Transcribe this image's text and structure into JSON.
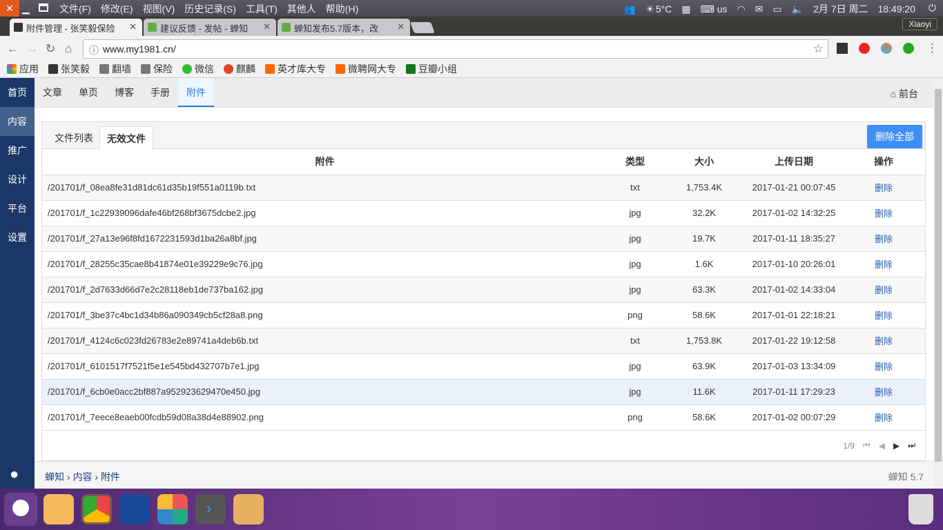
{
  "os": {
    "menu": [
      "文件(F)",
      "修改(E)",
      "视图(V)",
      "历史记录(S)",
      "工具(T)",
      "其他人",
      "帮助(H)"
    ],
    "temp": "5°C",
    "kbd": "us",
    "date": "2月 7日 周二",
    "time": "18:49:20",
    "user": "Xiaoyi"
  },
  "tabs": [
    {
      "title": "附件管理 - 张笑毅保险"
    },
    {
      "title": "建议反馈 - 发帖 - 蝉知"
    },
    {
      "title": "蝉知发布5.7版本，改"
    }
  ],
  "url": "www.my1981.cn/",
  "bookmarks": [
    "应用",
    "张笑毅",
    "翻墙",
    "保险",
    "微信",
    "麒麟",
    "英才库大专",
    "微聘网大专",
    "豆瓣小组"
  ],
  "sidebar": [
    "首页",
    "内容",
    "推广",
    "设计",
    "平台",
    "设置"
  ],
  "topnav": {
    "items": [
      "文章",
      "单页",
      "博客",
      "手册",
      "附件"
    ],
    "front": "前台"
  },
  "panel": {
    "tabs": [
      "文件列表",
      "无效文件"
    ],
    "delete_all": "删除全部"
  },
  "table": {
    "headers": [
      "附件",
      "类型",
      "大小",
      "上传日期",
      "操作"
    ],
    "rows": [
      [
        "/201701/f_08ea8fe31d81dc61d35b19f551a0119b.txt",
        "txt",
        "1,753.4K",
        "2017-01-21 00:07:45",
        "删除"
      ],
      [
        "/201701/f_1c22939096dafe46bf268bf3675dcbe2.jpg",
        "jpg",
        "32.2K",
        "2017-01-02 14:32:25",
        "删除"
      ],
      [
        "/201701/f_27a13e96f8fd1672231593d1ba26a8bf.jpg",
        "jpg",
        "19.7K",
        "2017-01-11 18:35:27",
        "删除"
      ],
      [
        "/201701/f_28255c35cae8b41874e01e39229e9c76.jpg",
        "jpg",
        "1.6K",
        "2017-01-10 20:26:01",
        "删除"
      ],
      [
        "/201701/f_2d7633d66d7e2c28118eb1de737ba162.jpg",
        "jpg",
        "63.3K",
        "2017-01-02 14:33:04",
        "删除"
      ],
      [
        "/201701/f_3be37c4bc1d34b86a090349cb5cf28a8.png",
        "png",
        "58.6K",
        "2017-01-01 22:18:21",
        "删除"
      ],
      [
        "/201701/f_4124c6c023fd26783e2e89741a4deb6b.txt",
        "txt",
        "1,753.8K",
        "2017-01-22 19:12:58",
        "删除"
      ],
      [
        "/201701/f_6101517f7521f5e1e545bd432707b7e1.jpg",
        "jpg",
        "63.9K",
        "2017-01-03 13:34:09",
        "删除"
      ],
      [
        "/201701/f_6cb0e0acc2bf887a952923629470e450.jpg",
        "jpg",
        "11.6K",
        "2017-01-11 17:29:23",
        "删除"
      ],
      [
        "/201701/f_7eece8eaeb00fcdb59d08a38d4e88902.png",
        "png",
        "58.6K",
        "2017-01-02 00:07:29",
        "删除"
      ]
    ]
  },
  "pager": {
    "text": "1/9"
  },
  "footer": {
    "crumbs": [
      "蝉知",
      "内容",
      "附件"
    ],
    "version": "蝉知 5.7"
  }
}
